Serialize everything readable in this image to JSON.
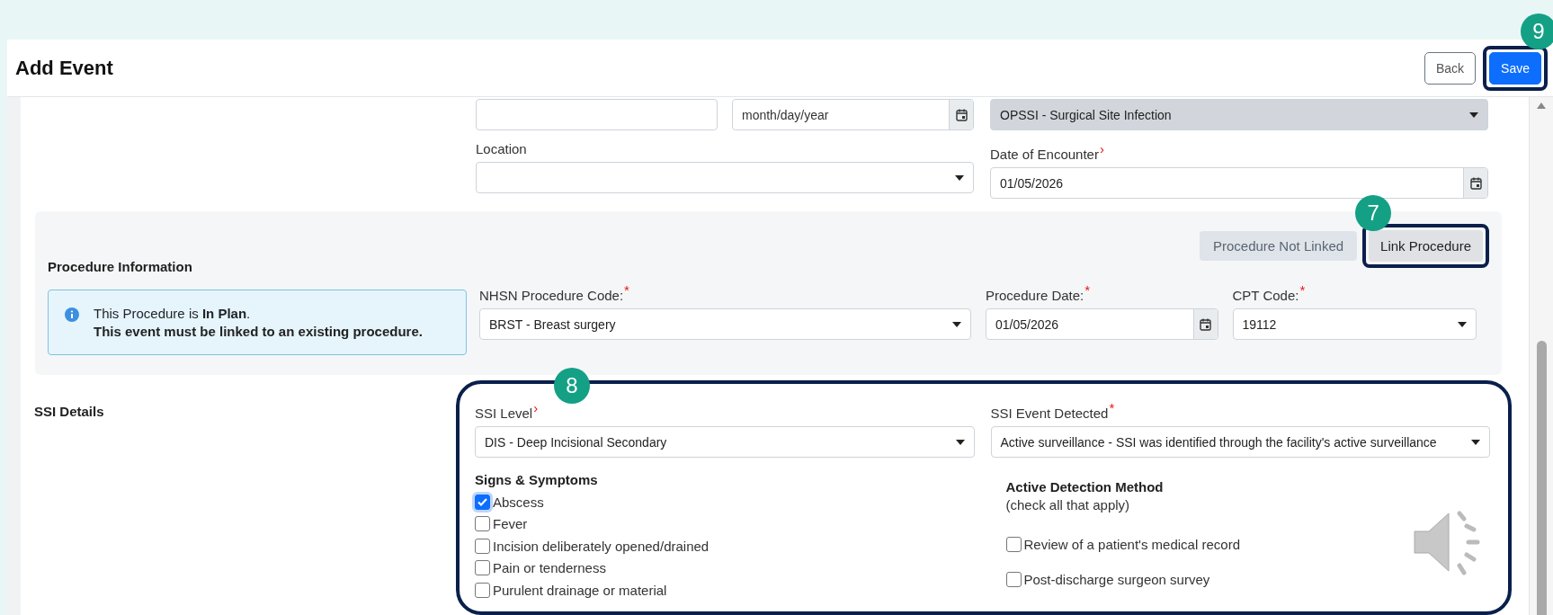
{
  "header": {
    "title": "Add Event",
    "buttons": [
      {
        "label": "Back",
        "kind": "secondary"
      },
      {
        "label": "Save",
        "kind": "primary",
        "callout": "9"
      }
    ]
  },
  "event_row": [
    {
      "kind": "text",
      "disabled": false
    },
    {
      "kind": "date",
      "placeholder": "month/day/year",
      "disabled": false
    },
    {
      "kind": "select",
      "value": "OPSSI - Surgical Site Infection",
      "disabled": true
    }
  ],
  "encounter_row": [
    {
      "kind": "select",
      "label": "Location",
      "disabled": false
    },
    {
      "kind": "date",
      "label": "Date of Encounter",
      "marker": "›",
      "value": "01/05/2026",
      "disabled": false
    }
  ],
  "procedure": {
    "title": "Procedure Information",
    "status": "Procedure Not Linked",
    "link_button": {
      "label": "Link Procedure",
      "callout": "7"
    },
    "notice": {
      "line1": "This Procedure is **In Plan**.",
      "line2": "This event must be linked to an existing procedure."
    },
    "fields": [
      {
        "kind": "select",
        "label": "NHSN Procedure Code:",
        "marker": "*",
        "value": "BRST - Breast surgery",
        "disabled": false
      },
      {
        "kind": "date",
        "label": "Procedure Date:",
        "marker": "*",
        "value": "01/05/2026",
        "disabled": false
      },
      {
        "kind": "select",
        "label": "CPT Code:",
        "marker": "*",
        "value": "19112",
        "disabled": false
      }
    ]
  },
  "ssi": {
    "title": "SSI Details",
    "callout": "8",
    "fields": [
      {
        "kind": "select",
        "label": "SSI Level",
        "marker": "›",
        "value": "DIS - Deep Incisional Secondary",
        "disabled": false
      },
      {
        "kind": "select",
        "label": "SSI Event Detected",
        "marker": "*",
        "value": "Active surveillance - SSI was identified through the facility's active surveillance",
        "disabled": false
      }
    ],
    "signs": {
      "title": "Signs & Symptoms",
      "items": [
        {
          "label": "Abscess",
          "checked": true
        },
        {
          "label": "Fever",
          "checked": false
        },
        {
          "label": "Incision deliberately opened/drained",
          "checked": false
        },
        {
          "label": "Pain or tenderness",
          "checked": false
        },
        {
          "label": "Purulent drainage or material",
          "checked": false
        }
      ]
    },
    "detection": {
      "title": "Active Detection Method",
      "hint": "(check all that apply)",
      "items": [
        {
          "label": "Review of a patient's medical record",
          "checked": false
        },
        {
          "label": "Post-discharge surgeon survey",
          "checked": false
        }
      ]
    }
  }
}
